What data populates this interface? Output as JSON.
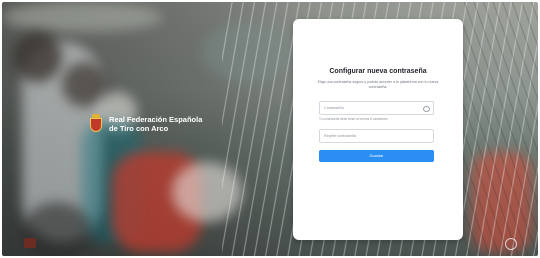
{
  "brand": {
    "line1": "Real Federación Española",
    "line2": "de Tiro con Arco"
  },
  "form": {
    "title": "Configurar nueva contraseña",
    "subtitle": "Elige una contraseña segura y podrás acceder a la plataforma con tu nueva contraseña.",
    "new_password_placeholder": "Contraseña",
    "password_hint": "Tu contraseña debe tener al menos 8 caracteres",
    "repeat_password_placeholder": "Repetir contraseña",
    "submit_label": "Guardar"
  },
  "colors": {
    "primary_button": "#2a8ef2",
    "card_background": "#ffffff"
  },
  "icons": {
    "visibility_toggle": "eye-icon",
    "brand_logo": "crest-logo"
  }
}
